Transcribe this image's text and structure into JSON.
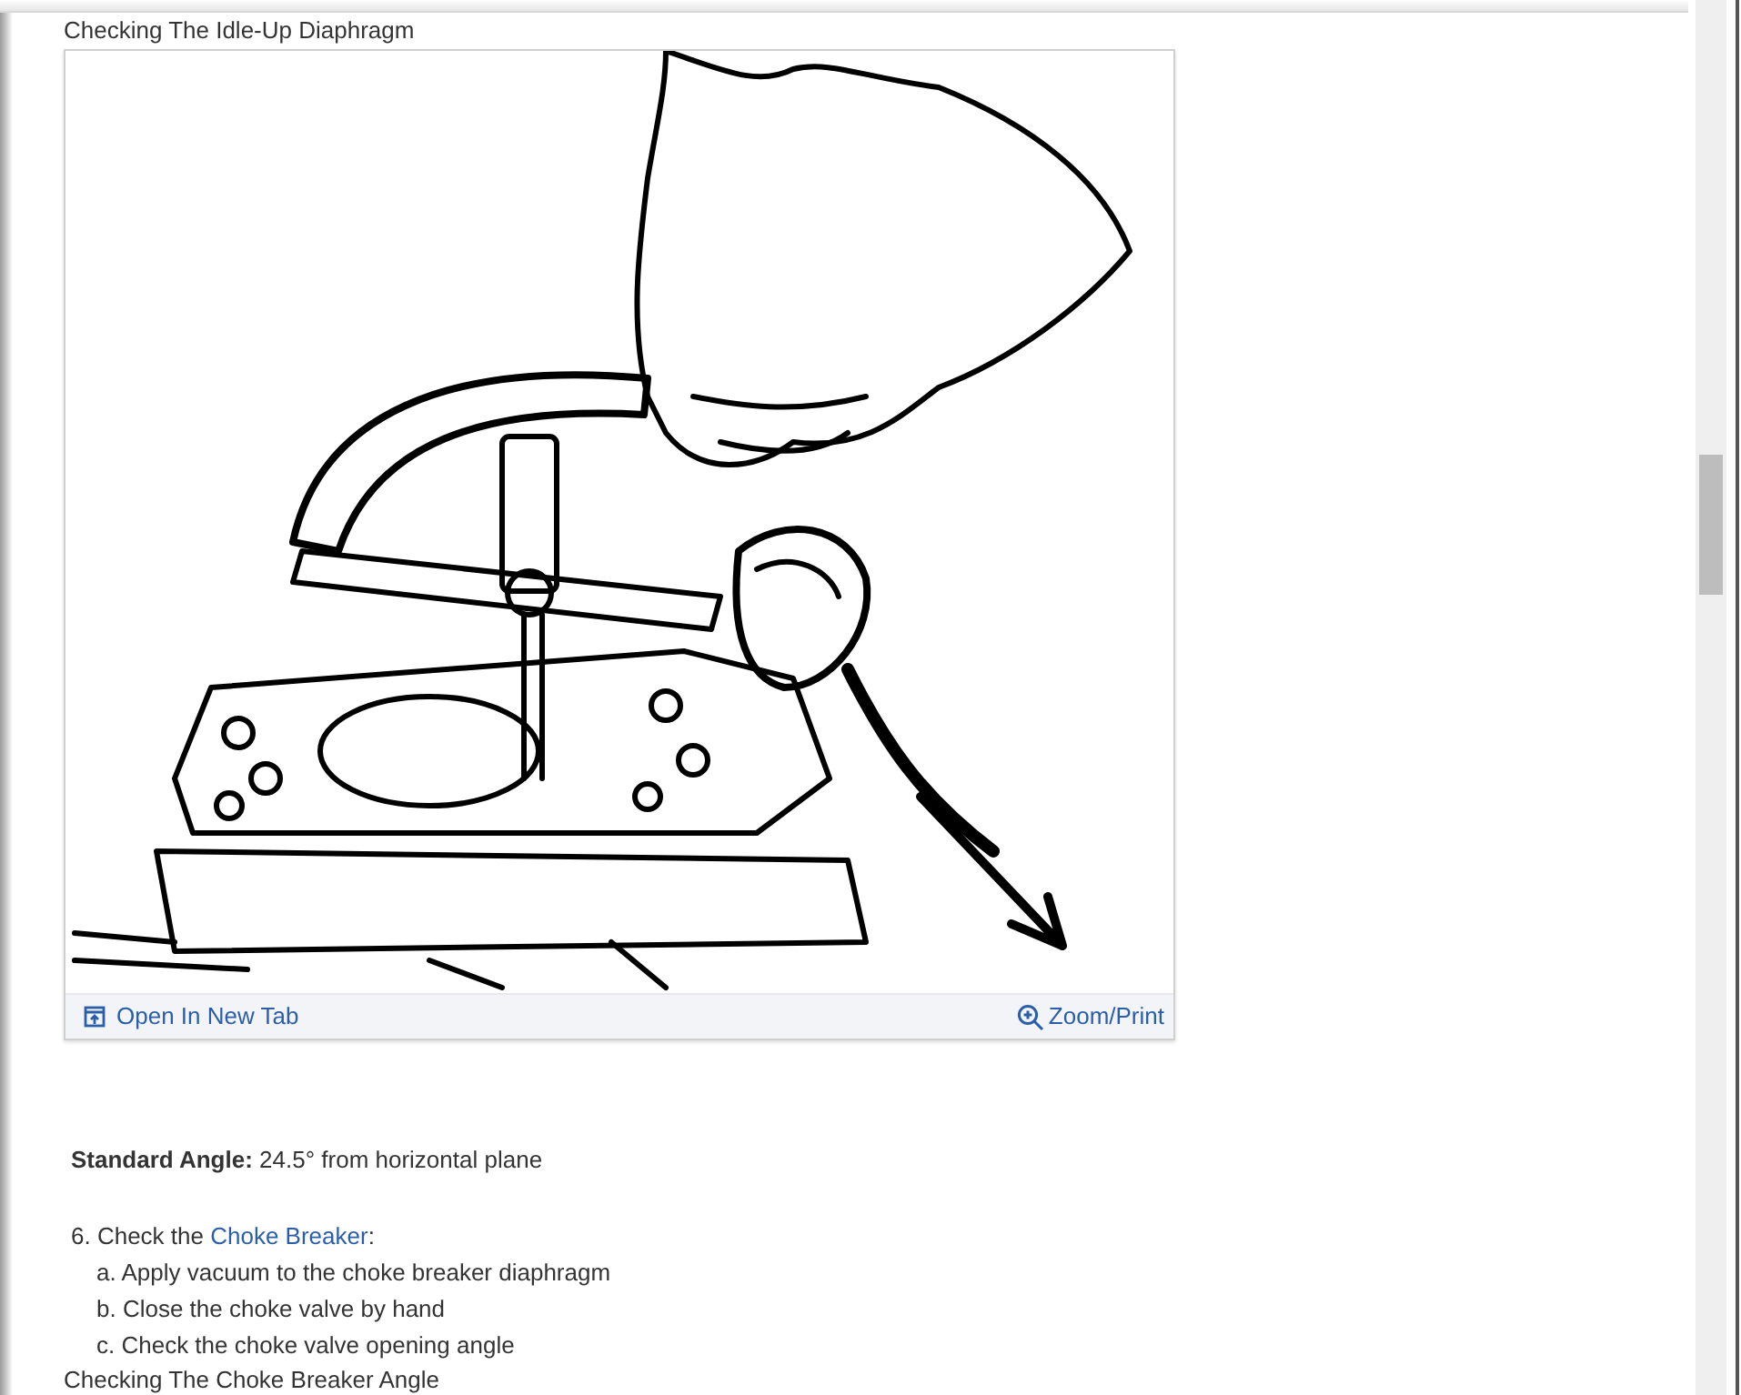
{
  "figure_caption": "Checking The Idle-Up Diaphragm",
  "figure": {
    "actions": [
      {
        "kind": "open",
        "label": "Open In New Tab"
      },
      {
        "kind": "zoom",
        "label": "Zoom/Print"
      }
    ]
  },
  "standard_angle": {
    "label": "Standard Angle:",
    "value": "24.5° from horizontal plane"
  },
  "step": {
    "prefix": "6. Check the ",
    "link": "Choke Breaker",
    "suffix": ":"
  },
  "substeps": [
    "a. Apply vacuum to the choke breaker diaphragm",
    "b. Close the choke valve by hand",
    "c. Check the choke valve opening angle"
  ],
  "next_caption": "Checking The Choke Breaker Angle"
}
